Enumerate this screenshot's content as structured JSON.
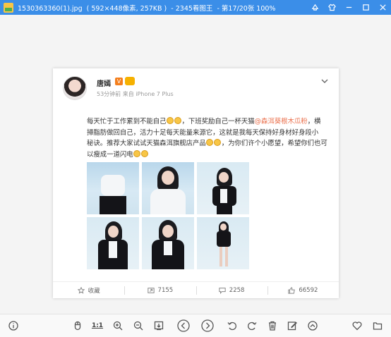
{
  "window": {
    "title": "1530363360(1).jpg  ( 592×448像素, 257KB )  - 2345看图王  - 第17/20张 100%",
    "controls": [
      "skin-icon",
      "shirt-icon",
      "minimize-icon",
      "maximize-icon",
      "close-icon"
    ]
  },
  "post": {
    "username": "唐嫣",
    "vip_badge": "V",
    "meta": "53分钟前 来自 iPhone 7 Plus",
    "text": {
      "l1_a": "每天忙于工作累到不能自己",
      "l1_b": "，下班奖励自己一杯天猫",
      "l1_link": "@森洱葵根木瓜粉",
      "l1_c": "，横",
      "l2": "掃脂肪做回自己，活力十足每天能量来源它，这就是我每天保持好身材好身段小",
      "l3_a": "秘诀。推荐大家试试天猫森洱旗舰店产品",
      "l3_b": "，为你们许个小愿望，希望你们也可",
      "l4": "以瘦成一道闪电"
    },
    "photo_count": 6
  },
  "actions": {
    "favorite_label": "收藏",
    "repost_count": "7155",
    "comment_count": "2258",
    "like_count": "66592"
  },
  "toolbar": {
    "actual_size_label": "1:1",
    "tools": [
      "info-icon",
      "mouse-icon",
      "actual-size",
      "zoom-in-icon",
      "zoom-out-icon",
      "fit-icon",
      "prev-icon",
      "next-icon",
      "rotate-left-icon",
      "rotate-right-icon",
      "delete-icon",
      "edit-icon",
      "up-icon",
      "favorite-icon",
      "more-icon"
    ]
  },
  "colors": {
    "titlebar": "#3b8ee8",
    "link": "#eb7350",
    "background": "#f4f4f4"
  }
}
